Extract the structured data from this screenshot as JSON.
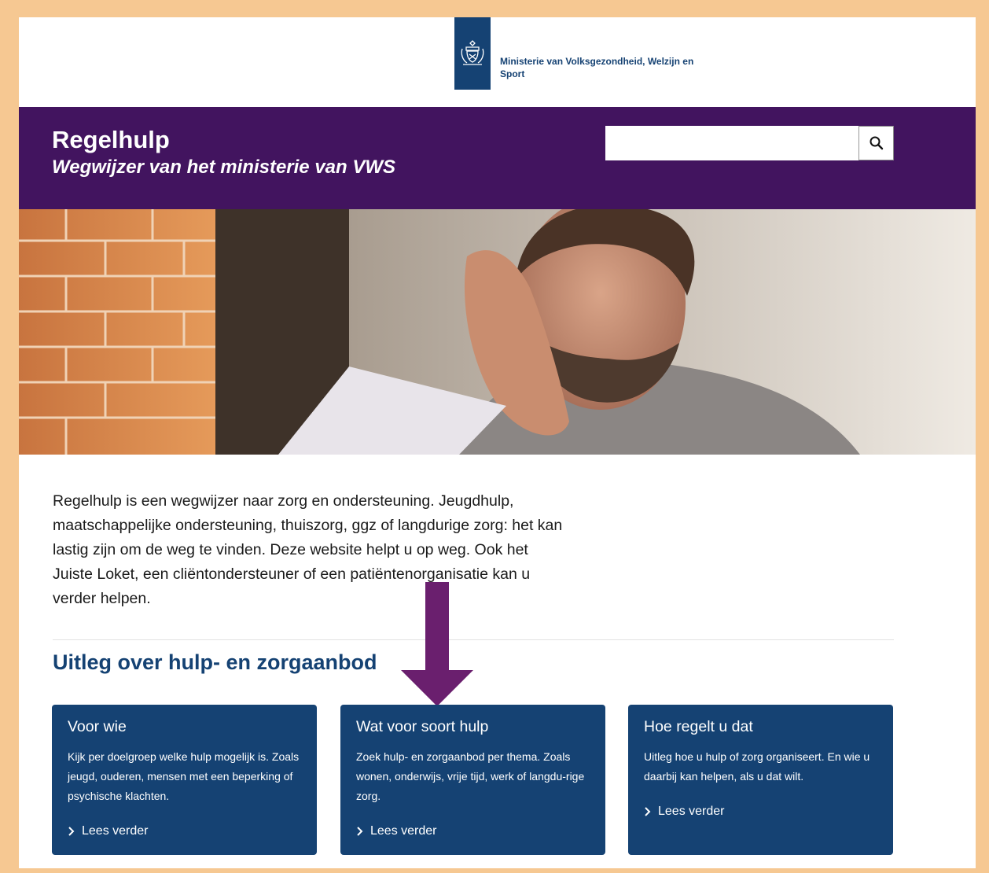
{
  "ministry": {
    "name": "Ministerie van Volksgezondheid, Welzijn en Sport"
  },
  "header": {
    "title": "Regelhulp",
    "subtitle": "Wegwijzer van het ministerie van VWS",
    "search_placeholder": ""
  },
  "hero": {
    "alt": "Man die bezorgd naar een document kijkt"
  },
  "intro": {
    "text": "Regelhulp is een wegwijzer naar zorg en ondersteuning. Jeugdhulp, maatschappelijke ondersteuning, thuiszorg, ggz of langdurige zorg: het kan lastig zijn om de weg te vinden. Deze website helpt u op weg. Ook het Juiste Loket, een cliëntondersteuner of een patiëntenorganisatie kan u verder helpen."
  },
  "section": {
    "title": "Uitleg over hulp- en zorgaanbod"
  },
  "cards": [
    {
      "title": "Voor wie",
      "text": "Kijk per doelgroep welke hulp mogelijk is. Zoals jeugd, ouderen, mensen met een beperking of psychische klachten.",
      "link": "Lees verder"
    },
    {
      "title": "Wat voor soort hulp",
      "text": "Zoek hulp- en zorgaanbod per thema. Zoals wonen, onderwijs, vrije tijd, werk of langdu-rige zorg.",
      "link": "Lees verder"
    },
    {
      "title": "Hoe regelt u dat",
      "text": "Uitleg hoe u hulp of zorg organiseert. En wie u daarbij kan helpen, als u dat wilt.",
      "link": "Lees verder"
    }
  ],
  "colors": {
    "header_purple": "#42145f",
    "card_blue": "#154273",
    "arrow_purple": "#6a1f6e",
    "frame_border": "#f6c892"
  },
  "icons": [
    "search-icon",
    "chevron-right-icon",
    "rijksoverheid-crest-icon"
  ]
}
